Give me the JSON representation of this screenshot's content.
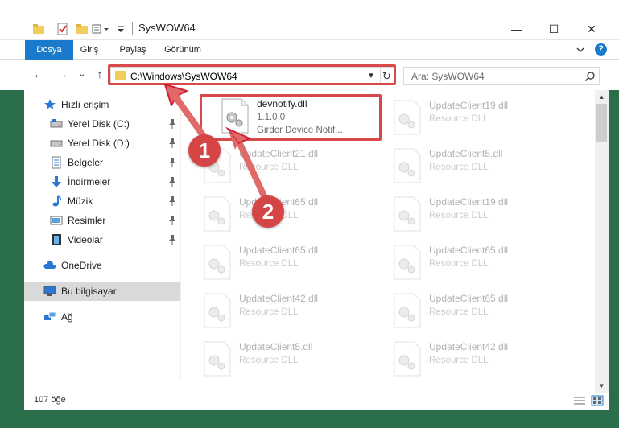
{
  "window": {
    "title": "SysWOW64",
    "minimize": "—",
    "maximize": "☐",
    "close": "✕"
  },
  "ribbon": {
    "tabs": [
      "Dosya",
      "Giriş",
      "Paylaş",
      "Görünüm"
    ],
    "help": "?"
  },
  "nav": {
    "back": "←",
    "forward": "→",
    "recent": "⌄",
    "up": "↑",
    "address": "C:\\Windows\\SysWOW64",
    "search_placeholder": "Ara: SysWOW64"
  },
  "sidebar": {
    "items": [
      {
        "label": "Hızlı erişim",
        "icon": "star-icon"
      },
      {
        "label": "Yerel Disk (C:)",
        "icon": "drive-icon",
        "pinned": true
      },
      {
        "label": "Yerel Disk (D:)",
        "icon": "drive-icon",
        "pinned": true
      },
      {
        "label": "Belgeler",
        "icon": "documents-icon",
        "pinned": true
      },
      {
        "label": "İndirmeler",
        "icon": "download-icon",
        "pinned": true
      },
      {
        "label": "Müzik",
        "icon": "music-icon",
        "pinned": true
      },
      {
        "label": "Resimler",
        "icon": "pictures-icon",
        "pinned": true
      },
      {
        "label": "Videolar",
        "icon": "videos-icon",
        "pinned": true
      },
      {
        "label": "OneDrive",
        "icon": "cloud-icon"
      },
      {
        "label": "Bu bilgisayar",
        "icon": "computer-icon"
      },
      {
        "label": "Ağ",
        "icon": "network-icon"
      }
    ]
  },
  "files": {
    "selected": {
      "name": "devnotify.dll",
      "version": "1.1.0.0",
      "description": "Girder Device Notif..."
    },
    "left_column": [
      {
        "name": "UpdateClient21.dll",
        "description": "Resource DLL"
      },
      {
        "name": "UpdateClient65.dll",
        "description": "Resource DLL"
      },
      {
        "name": "UpdateClient65.dll",
        "description": "Resource DLL"
      },
      {
        "name": "UpdateClient42.dll",
        "description": "Resource DLL"
      },
      {
        "name": "UpdateClient5.dll",
        "description": "Resource DLL"
      }
    ],
    "right_column": [
      {
        "name": "UpdateClient19.dll",
        "description": "Resource DLL"
      },
      {
        "name": "UpdateClient5.dll",
        "description": "Resource DLL"
      },
      {
        "name": "UpdateClient19.dll",
        "description": "Resource DLL"
      },
      {
        "name": "UpdateClient65.dll",
        "description": "Resource DLL"
      },
      {
        "name": "UpdateClient65.dll",
        "description": "Resource DLL"
      },
      {
        "name": "UpdateClient42.dll",
        "description": "Resource DLL"
      }
    ]
  },
  "status": {
    "count": "107 öğe"
  },
  "annotations": {
    "badge1": "1",
    "badge2": "2"
  },
  "colors": {
    "accent": "#1979ca",
    "highlight": "#d9494a",
    "selection": "#d9d9d9"
  }
}
